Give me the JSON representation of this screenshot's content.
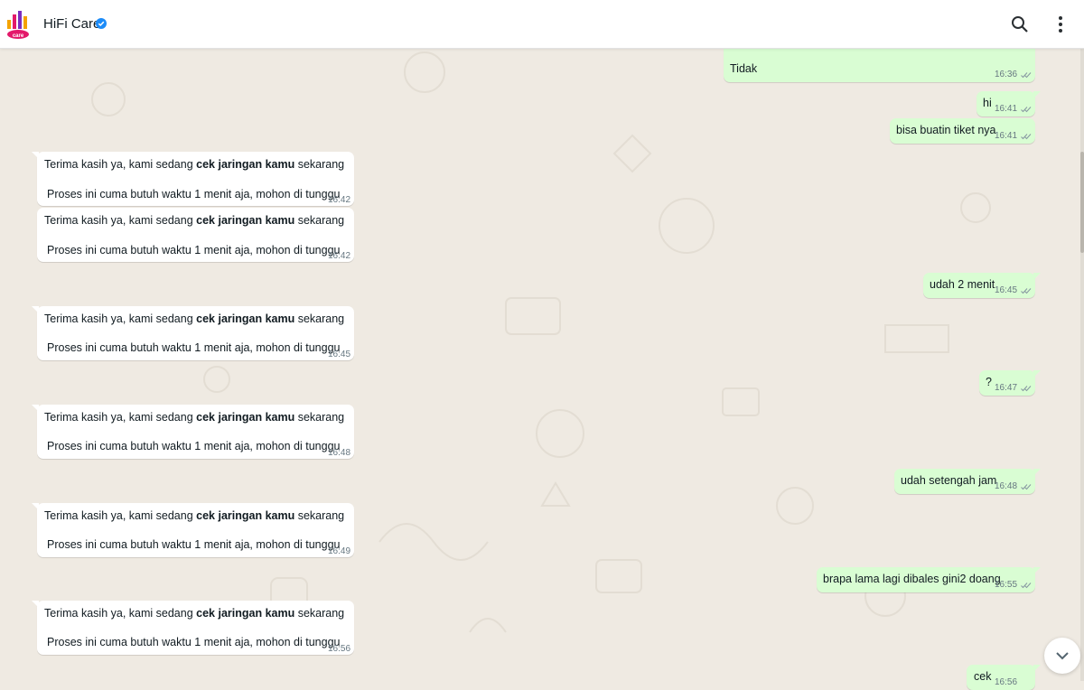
{
  "header": {
    "title": "HiFi Care",
    "logo_text": "care"
  },
  "incoming_template": {
    "line1_pre": "Terima kasih ya, kami sedang ",
    "line1_bold": "cek jaringan kamu",
    "line1_post": " sekarang",
    "line2": "Proses ini cuma butuh waktu 1 menit aja, mohon di tunggu"
  },
  "messages_out": [
    {
      "text": "Tidak",
      "time": "16:36"
    },
    {
      "text": "hi",
      "time": "16:41"
    },
    {
      "text": "bisa buatin tiket nya",
      "time": "16:41"
    },
    {
      "text": "udah 2 menit",
      "time": "16:45"
    },
    {
      "text": "?",
      "time": "16:47"
    },
    {
      "text": "udah setengah jam",
      "time": "16:48"
    },
    {
      "text": "brapa lama lagi dibales gini2 doang",
      "time": "16:55"
    },
    {
      "text": "cek",
      "time": "16:56"
    }
  ],
  "messages_in_times": [
    "16:42",
    "16:42",
    "16:45",
    "16:48",
    "16:49",
    "16:56"
  ],
  "colors": {
    "outgoing_bubble": "#d9fdd3",
    "incoming_bubble": "#ffffff",
    "wallpaper": "#efeae2",
    "verified_badge": "#1d8cf8",
    "tick_gray": "#8696a0"
  },
  "icons": [
    "logo-icon",
    "verified-icon",
    "search-icon",
    "more-vert-icon",
    "double-check-icon",
    "chevron-down-icon"
  ]
}
